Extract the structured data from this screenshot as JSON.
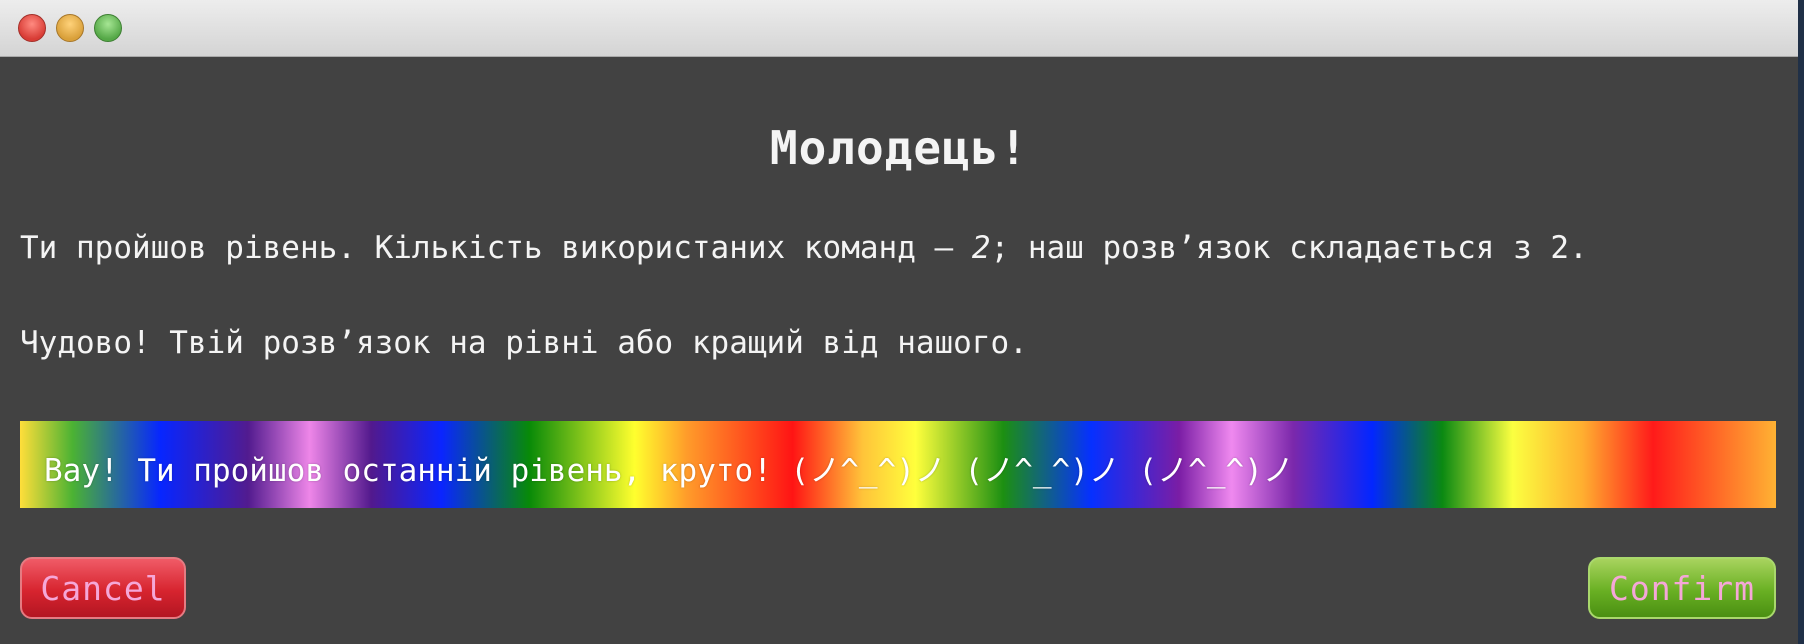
{
  "window": {
    "controls": [
      "close",
      "minimize",
      "zoom"
    ]
  },
  "dialog": {
    "title": "Молодець!",
    "result_line_prefix": "Ти пройшов рівень. Кількість використаних команд — ",
    "result_used_commands": "2",
    "result_line_suffix": "; наш розв’язок складається з 2.",
    "praise_line": "Чудово! Твій розв’язок на рівні або кращий від нашого.",
    "final_banner": "Вау! Ти пройшов останній рівень, круто! (ノ^_^)ノ (ノ^_^)ノ (ノ^_^)ノ"
  },
  "buttons": {
    "cancel_label": "Cancel",
    "confirm_label": "Confirm"
  },
  "colors": {
    "background": "#424242",
    "text": "#f4f4f4",
    "cancel": "#d7242f",
    "confirm": "#69b023",
    "button_text": "#f5a7d8"
  }
}
